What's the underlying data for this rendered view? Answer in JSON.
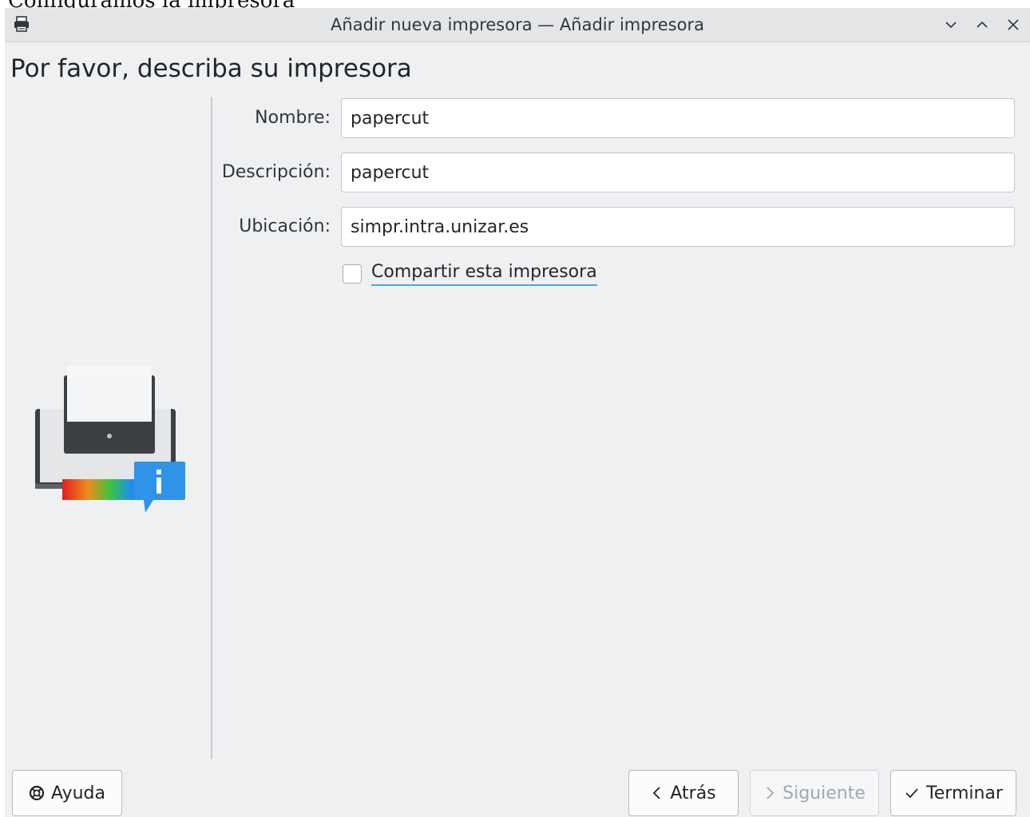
{
  "caption": "Configuramos la impresora",
  "window": {
    "title": "Añadir nueva impresora — Añadir impresora",
    "controls": [
      "minimize",
      "maximize",
      "close"
    ]
  },
  "page": {
    "heading": "Por favor, describa su impresora"
  },
  "form": {
    "name_label": "Nombre:",
    "name_value": "papercut",
    "description_label": "Descripción:",
    "description_value": "papercut",
    "location_label": "Ubicación:",
    "location_value": "simpr.intra.unizar.es",
    "share_label": "Compartir esta impresora",
    "share_checked": false
  },
  "buttons": {
    "help": "Ayuda",
    "back": "Atrás",
    "next": "Siguiente",
    "finish": "Terminar"
  },
  "icons": {
    "app": "printer-icon",
    "side": "printer-info-illustration"
  },
  "colors": {
    "accent": "#3daee9",
    "window_bg": "#eff0f1",
    "titlebar_bg": "#e3e5e7"
  }
}
